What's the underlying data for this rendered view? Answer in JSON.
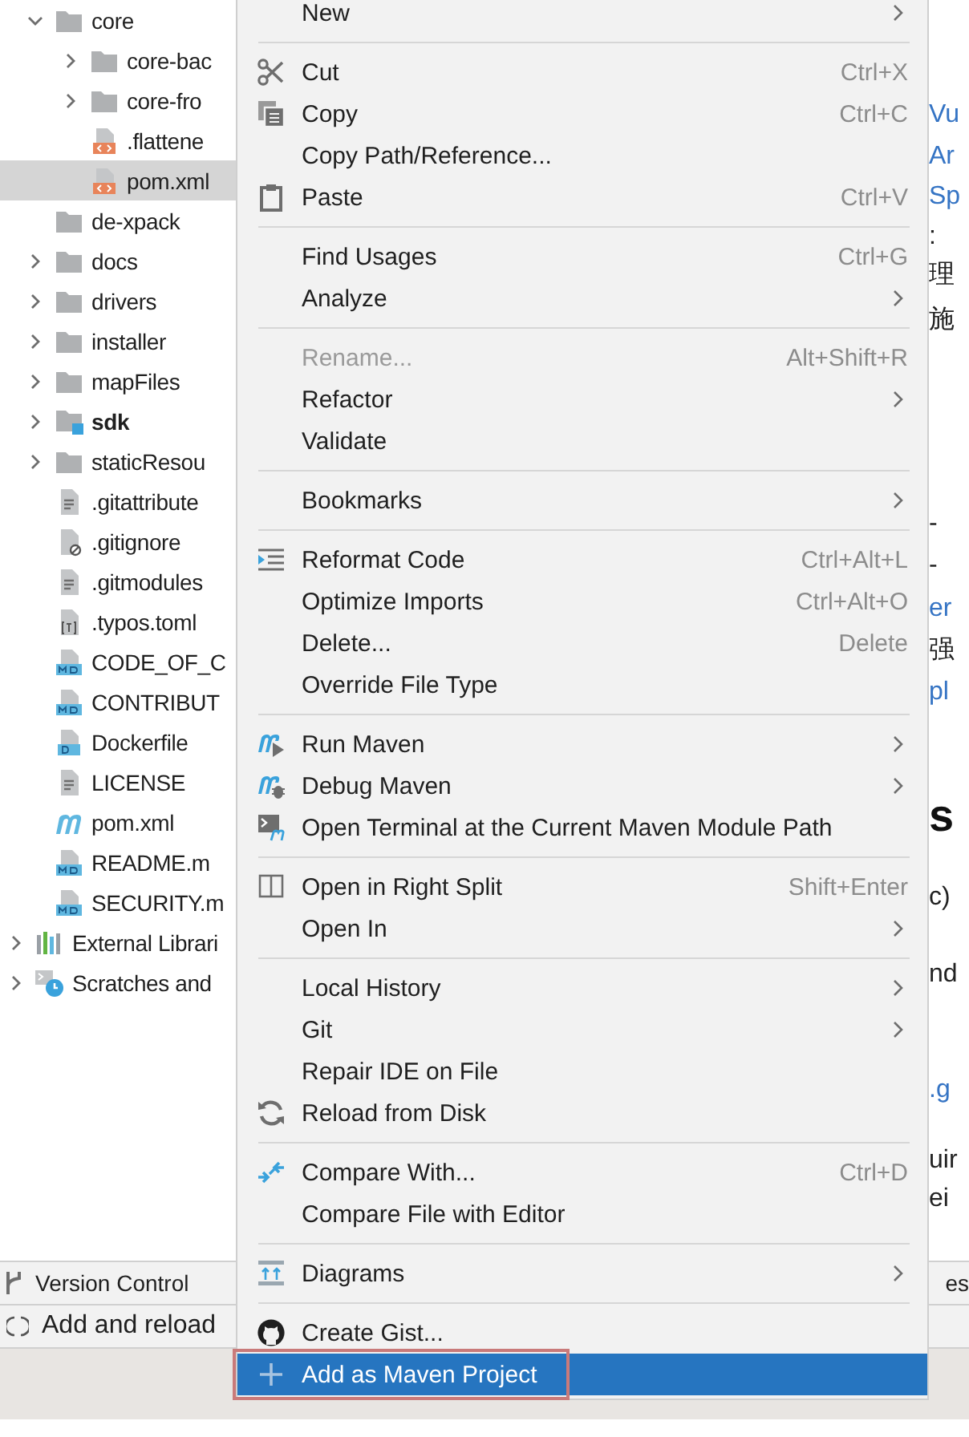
{
  "project_tree": {
    "items": [
      {
        "label": "core",
        "kind": "folder",
        "expanded": true,
        "selected": false,
        "children": [
          {
            "label": "core-bac",
            "kind": "folder",
            "expanded": false,
            "selected": false
          },
          {
            "label": "core-fro",
            "kind": "folder",
            "expanded": false,
            "selected": false
          },
          {
            "label": ".flattene",
            "kind": "xml",
            "selected": false
          },
          {
            "label": "pom.xml",
            "kind": "xml",
            "selected": true
          }
        ]
      },
      {
        "label": "de-xpack",
        "kind": "folder",
        "selected": false
      },
      {
        "label": "docs",
        "kind": "folder",
        "expanded": false,
        "selected": false
      },
      {
        "label": "drivers",
        "kind": "folder",
        "expanded": false,
        "selected": false
      },
      {
        "label": "installer",
        "kind": "folder",
        "expanded": false,
        "selected": false
      },
      {
        "label": "mapFiles",
        "kind": "folder",
        "expanded": false,
        "selected": false
      },
      {
        "label": "sdk",
        "kind": "module",
        "expanded": false,
        "selected": false
      },
      {
        "label": "staticResou",
        "kind": "folder",
        "expanded": false,
        "selected": false
      },
      {
        "label": ".gitattribute",
        "kind": "text",
        "selected": false
      },
      {
        "label": ".gitignore",
        "kind": "ignore",
        "selected": false
      },
      {
        "label": ".gitmodules",
        "kind": "text",
        "selected": false
      },
      {
        "label": ".typos.toml",
        "kind": "toml",
        "selected": false
      },
      {
        "label": "CODE_OF_C",
        "kind": "md",
        "selected": false
      },
      {
        "label": "CONTRIBUT",
        "kind": "md",
        "selected": false
      },
      {
        "label": "Dockerfile",
        "kind": "docker",
        "selected": false
      },
      {
        "label": "LICENSE",
        "kind": "text",
        "selected": false
      },
      {
        "label": "pom.xml",
        "kind": "maven",
        "selected": false
      },
      {
        "label": "README.m",
        "kind": "md",
        "selected": false
      },
      {
        "label": "SECURITY.m",
        "kind": "md",
        "selected": false
      }
    ],
    "root_items": [
      {
        "label": "External Librari",
        "kind": "libraries",
        "expanded": false,
        "selected": false
      },
      {
        "label": "Scratches and",
        "kind": "scratches",
        "expanded": false,
        "selected": false
      }
    ]
  },
  "editor": {
    "fragments": [
      {
        "text": "Vu",
        "kind": "link"
      },
      {
        "text": "Ar",
        "kind": "link"
      },
      {
        "text": "Sp",
        "kind": "link"
      },
      {
        "text": ":",
        "kind": "text"
      },
      {
        "text": "理",
        "kind": "text"
      },
      {
        "text": "施",
        "kind": "text"
      },
      {
        "text": "-",
        "kind": "text"
      },
      {
        "text": "-",
        "kind": "text"
      },
      {
        "text": "er",
        "kind": "link"
      },
      {
        "text": "强",
        "kind": "text"
      },
      {
        "text": "pl",
        "kind": "link"
      },
      {
        "text": "s",
        "kind": "heading"
      },
      {
        "text": "c)",
        "kind": "text"
      },
      {
        "text": "nd",
        "kind": "text"
      },
      {
        "text": ".g",
        "kind": "link"
      },
      {
        "text": "uir",
        "kind": "text"
      },
      {
        "text": "ei",
        "kind": "text"
      }
    ]
  },
  "tool_window_bar": {
    "label": "Version Control",
    "right_label": "es"
  },
  "status_bar": {
    "text": "Add and reload"
  },
  "context_menu": {
    "groups": [
      [
        {
          "label": "New",
          "submenu": true,
          "disabled": false,
          "selected": false
        }
      ],
      [
        {
          "label": "Cut",
          "shortcut": "Ctrl+X",
          "kind": "cut",
          "submenu": false,
          "disabled": false,
          "selected": false
        },
        {
          "label": "Copy",
          "shortcut": "Ctrl+C",
          "kind": "copy",
          "submenu": false,
          "disabled": false,
          "selected": false
        },
        {
          "label": "Copy Path/Reference...",
          "submenu": false,
          "disabled": false,
          "selected": false
        },
        {
          "label": "Paste",
          "shortcut": "Ctrl+V",
          "kind": "paste",
          "submenu": false,
          "disabled": false,
          "selected": false
        }
      ],
      [
        {
          "label": "Find Usages",
          "shortcut": "Ctrl+G",
          "submenu": false,
          "disabled": false,
          "selected": false
        },
        {
          "label": "Analyze",
          "submenu": true,
          "disabled": false,
          "selected": false
        }
      ],
      [
        {
          "label": "Rename...",
          "shortcut": "Alt+Shift+R",
          "submenu": false,
          "disabled": true,
          "selected": false
        },
        {
          "label": "Refactor",
          "submenu": true,
          "disabled": false,
          "selected": false
        },
        {
          "label": "Validate",
          "submenu": false,
          "disabled": false,
          "selected": false
        }
      ],
      [
        {
          "label": "Bookmarks",
          "submenu": true,
          "disabled": false,
          "selected": false
        }
      ],
      [
        {
          "label": "Reformat Code",
          "shortcut": "Ctrl+Alt+L",
          "kind": "reformat",
          "submenu": false,
          "disabled": false,
          "selected": false
        },
        {
          "label": "Optimize Imports",
          "shortcut": "Ctrl+Alt+O",
          "submenu": false,
          "disabled": false,
          "selected": false
        },
        {
          "label": "Delete...",
          "shortcut": "Delete",
          "submenu": false,
          "disabled": false,
          "selected": false
        },
        {
          "label": "Override File Type",
          "submenu": false,
          "disabled": false,
          "selected": false
        }
      ],
      [
        {
          "label": "Run Maven",
          "kind": "maven-run",
          "submenu": true,
          "disabled": false,
          "selected": false
        },
        {
          "label": "Debug Maven",
          "kind": "maven-debug",
          "submenu": true,
          "disabled": false,
          "selected": false
        },
        {
          "label": "Open Terminal at the Current Maven Module Path",
          "kind": "terminal",
          "submenu": false,
          "disabled": false,
          "selected": false
        }
      ],
      [
        {
          "label": "Open in Right Split",
          "shortcut": "Shift+Enter",
          "kind": "split",
          "submenu": false,
          "disabled": false,
          "selected": false
        },
        {
          "label": "Open In",
          "submenu": true,
          "disabled": false,
          "selected": false
        }
      ],
      [
        {
          "label": "Local History",
          "submenu": true,
          "disabled": false,
          "selected": false
        },
        {
          "label": "Git",
          "submenu": true,
          "disabled": false,
          "selected": false
        },
        {
          "label": "Repair IDE on File",
          "submenu": false,
          "disabled": false,
          "selected": false
        },
        {
          "label": "Reload from Disk",
          "kind": "reload",
          "submenu": false,
          "disabled": false,
          "selected": false
        }
      ],
      [
        {
          "label": "Compare With...",
          "shortcut": "Ctrl+D",
          "kind": "compare",
          "submenu": false,
          "disabled": false,
          "selected": false
        },
        {
          "label": "Compare File with Editor",
          "submenu": false,
          "disabled": false,
          "selected": false
        }
      ],
      [
        {
          "label": "Diagrams",
          "kind": "diagrams",
          "submenu": true,
          "disabled": false,
          "selected": false
        }
      ],
      [
        {
          "label": "Create Gist...",
          "kind": "gist",
          "submenu": false,
          "disabled": false,
          "selected": false
        },
        {
          "label": "Add as Maven Project",
          "kind": "add",
          "submenu": false,
          "disabled": false,
          "selected": true,
          "outlined": true
        }
      ]
    ]
  }
}
